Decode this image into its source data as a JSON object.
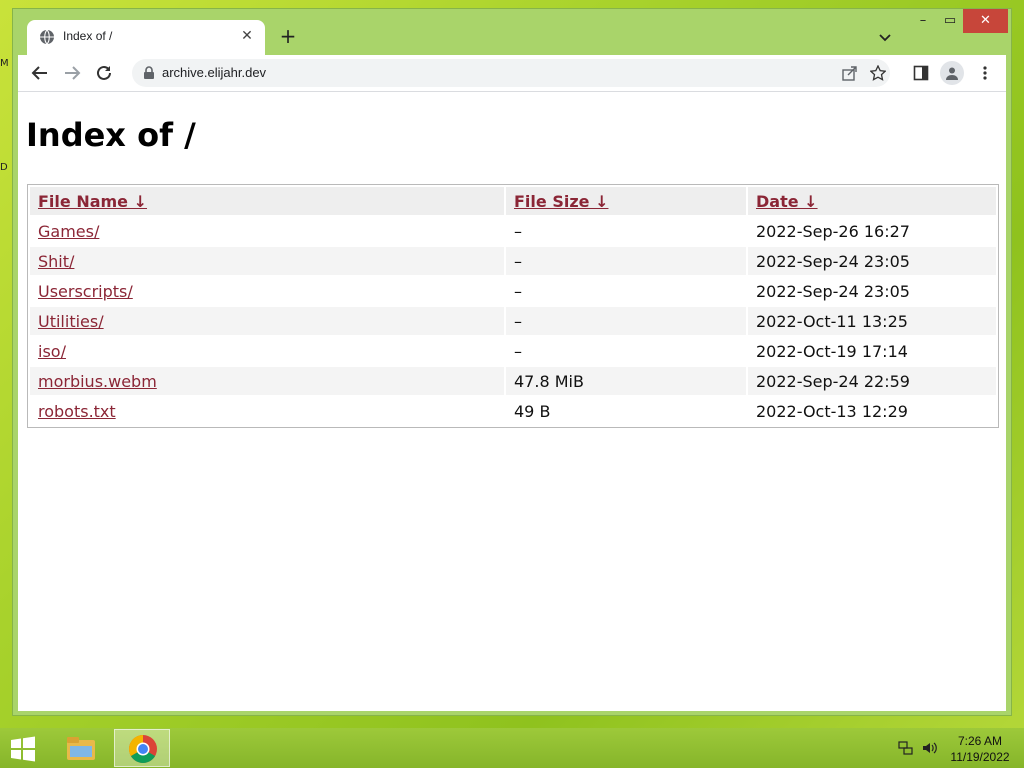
{
  "desktop": {
    "edge_letters": [
      "M",
      "D"
    ]
  },
  "browser": {
    "tab": {
      "title": "Index of /"
    },
    "address_bar": {
      "url": "archive.elijahr.dev"
    }
  },
  "page": {
    "heading": "Index of /",
    "table": {
      "headers": {
        "name": "File Name  ↓",
        "size": "File Size  ↓",
        "date": "Date  ↓"
      },
      "rows": [
        {
          "name": "Games/",
          "size": "–",
          "date": "2022-Sep-26 16:27"
        },
        {
          "name": "Shit/",
          "size": "–",
          "date": "2022-Sep-24 23:05"
        },
        {
          "name": "Userscripts/",
          "size": "–",
          "date": "2022-Sep-24 23:05"
        },
        {
          "name": "Utilities/",
          "size": "–",
          "date": "2022-Oct-11 13:25"
        },
        {
          "name": "iso/",
          "size": "–",
          "date": "2022-Oct-19 17:14"
        },
        {
          "name": "morbius.webm",
          "size": "47.8 MiB",
          "date": "2022-Sep-24 22:59"
        },
        {
          "name": "robots.txt",
          "size": "49 B",
          "date": "2022-Oct-13 12:29"
        }
      ]
    }
  },
  "taskbar": {
    "clock": {
      "time": "7:26 AM",
      "date": "11/19/2022"
    }
  },
  "colors": {
    "link": "#8b2636",
    "desktop": "#a8d22c",
    "close_button": "#c7463a"
  },
  "icons": [
    "globe-icon",
    "close-icon",
    "plus-icon",
    "chevron-down-icon",
    "back-arrow-icon",
    "forward-arrow-icon",
    "reload-icon",
    "lock-icon",
    "share-icon",
    "star-icon",
    "side-panel-icon",
    "profile-icon",
    "kebab-menu-icon",
    "windows-start-icon",
    "file-explorer-icon",
    "chrome-icon",
    "network-icon",
    "volume-icon"
  ]
}
